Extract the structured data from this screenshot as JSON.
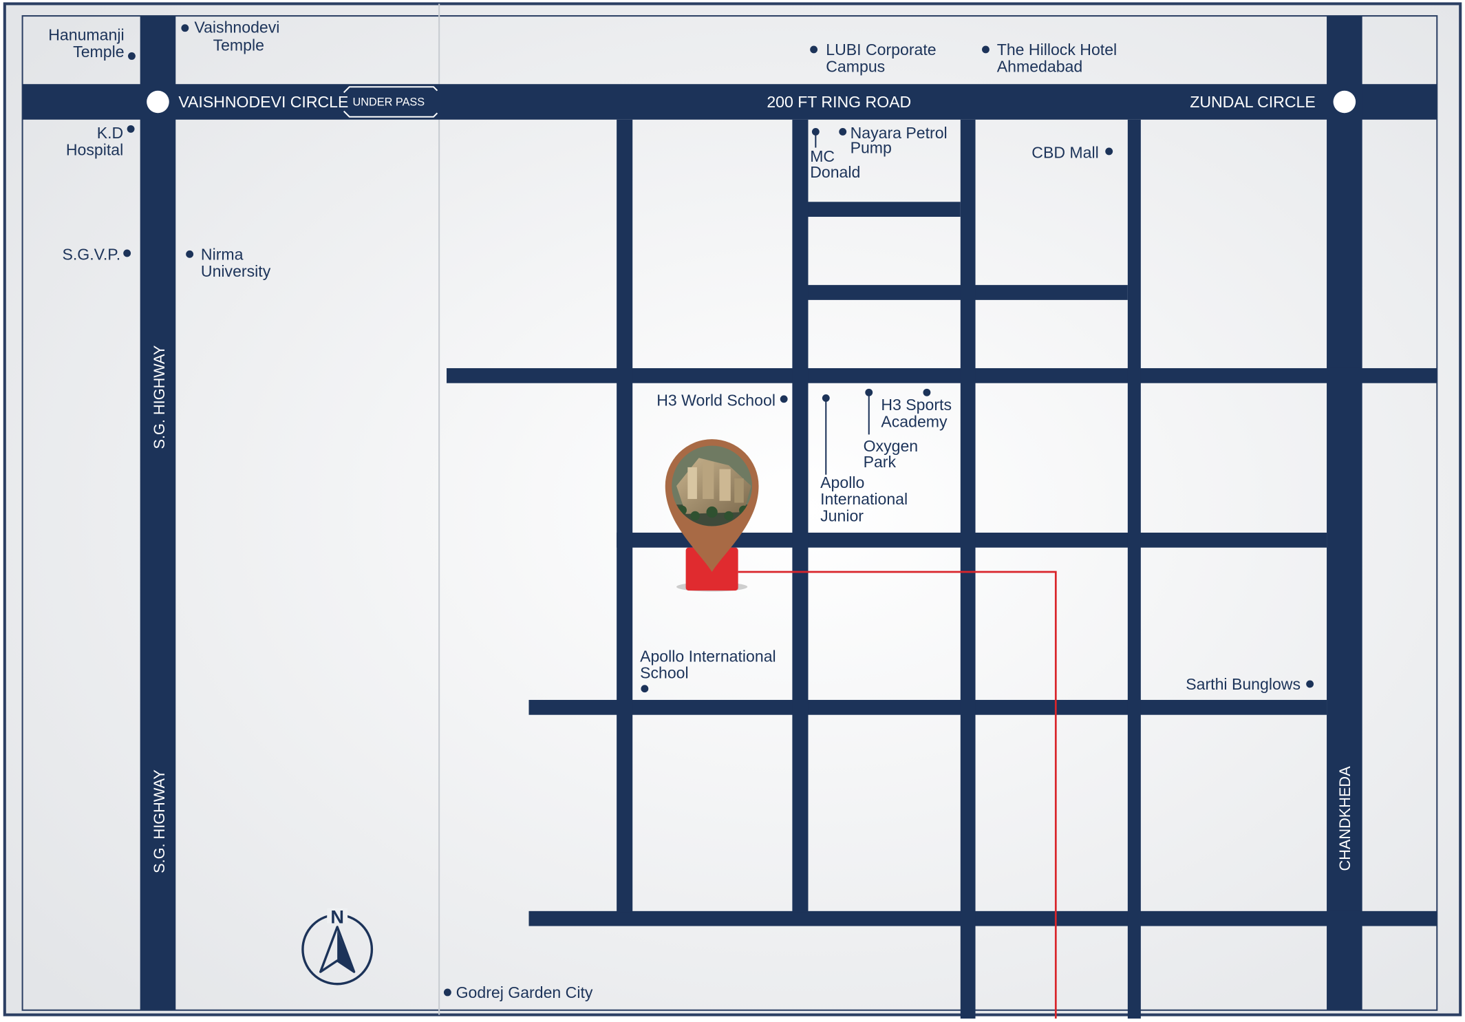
{
  "roads": {
    "ring_road": "200 FT RING ROAD",
    "sg_highway_top": "S.G. HIGHWAY",
    "sg_highway_bottom": "S.G. HIGHWAY",
    "chandkheda": "CHANDKHEDA"
  },
  "circles": {
    "vaishnodevi": "VAISHNODEVI CIRCLE",
    "zundal": "ZUNDAL CIRCLE",
    "underpass": "UNDER PASS"
  },
  "landmarks": {
    "hanumanji_1": "Hanumanji",
    "hanumanji_2": "Temple",
    "vaishnodevi_1": "Vaishnodevi",
    "vaishnodevi_2": "Temple",
    "lubi_1": "LUBI Corporate",
    "lubi_2": "Campus",
    "hillock_1": "The Hillock Hotel",
    "hillock_2": "Ahmedabad",
    "kd_1": "K.D",
    "kd_2": "Hospital",
    "sgvp": "S.G.V.P.",
    "nirma_1": "Nirma",
    "nirma_2": "University",
    "mc_1": "MC",
    "mc_2": "Donald",
    "nayara_1": "Nayara Petrol",
    "nayara_2": "Pump",
    "cbd": "CBD Mall",
    "h3world": "H3 World School",
    "h3sports_1": "H3 Sports",
    "h3sports_2": "Academy",
    "oxygen_1": "Oxygen",
    "oxygen_2": "Park",
    "apollo_jr_1": "Apollo",
    "apollo_jr_2": "International",
    "apollo_jr_3": "Junior",
    "apollo_1": "Apollo International",
    "apollo_2": "School",
    "sarthi": "Sarthi Bunglows",
    "godrej": "Godrej Garden City"
  },
  "compass": {
    "label": "N"
  },
  "colors": {
    "road": "#1c3359",
    "background": "#eef0f2",
    "route": "#d9252b",
    "pin": "#a86a45",
    "site": "#e02b2f",
    "text": "#1c3359"
  }
}
